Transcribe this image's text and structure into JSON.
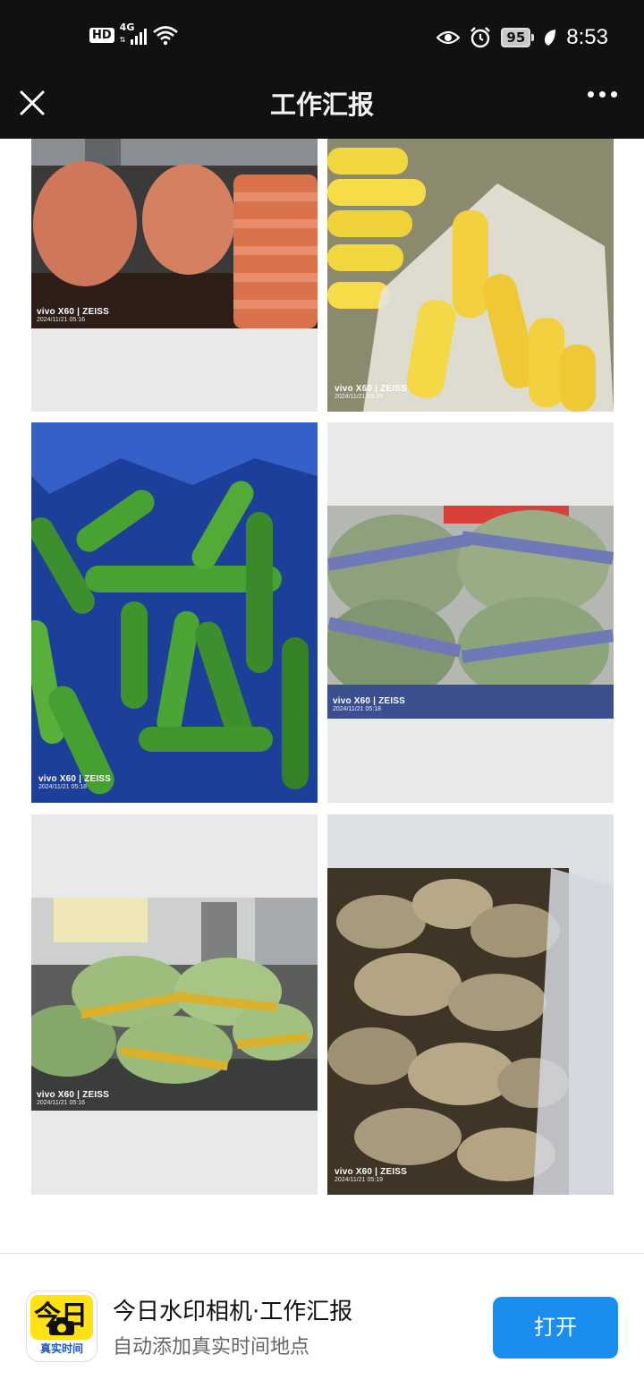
{
  "status_bar": {
    "hd": "HD",
    "network": "4G",
    "battery": "95",
    "time": "8:53",
    "icons": [
      "signal-icon",
      "wifi-icon",
      "eye-icon",
      "alarm-icon",
      "battery-icon",
      "leaf-icon"
    ]
  },
  "header": {
    "title": "工作汇报",
    "close_icon": "close-icon",
    "more_icon": "more-icon"
  },
  "photos": [
    {
      "subject": "carrots",
      "watermark_brand": "vivo X60 | ZEISS",
      "watermark_time": "2024/11/21 05:16"
    },
    {
      "subject": "corn",
      "watermark_brand": "vivo X60 | ZEISS",
      "watermark_time": "2024/11/21 05:15"
    },
    {
      "subject": "green-peppers",
      "watermark_brand": "vivo X60 | ZEISS",
      "watermark_time": "2024/11/21 05:18"
    },
    {
      "subject": "bagged-greens",
      "watermark_brand": "vivo X60 | ZEISS",
      "watermark_time": "2024/11/21 05:18"
    },
    {
      "subject": "bagged-vegetables",
      "watermark_brand": "vivo X60 | ZEISS",
      "watermark_time": "2024/11/21 05:16"
    },
    {
      "subject": "ginger",
      "watermark_brand": "vivo X60 | ZEISS",
      "watermark_time": "2024/11/21 05:19"
    }
  ],
  "app_banner": {
    "icon_glyph": "今日",
    "icon_label": "真实时间",
    "title": "今日水印相机·工作汇报",
    "subtitle": "自动添加真实时间地点",
    "open_button": "打开"
  },
  "colors": {
    "header_bg": "#111111",
    "button_blue": "#1a8df0",
    "icon_yellow": "#ffe114"
  }
}
